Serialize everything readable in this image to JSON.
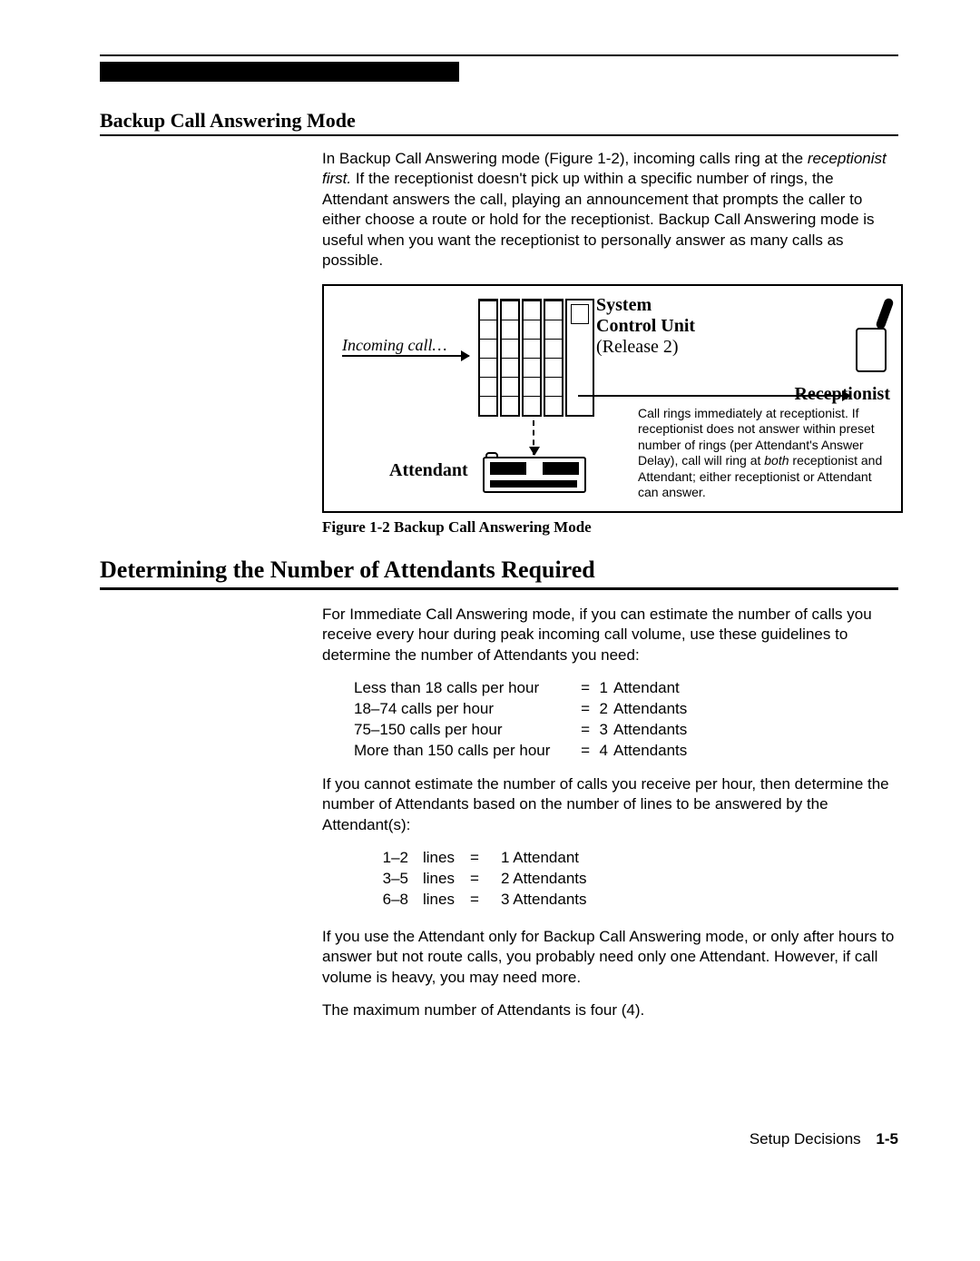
{
  "section1": {
    "title": "Backup Call Answering Mode",
    "para": "In Backup Call Answering mode (Figure 1-2), incoming calls ring at the ",
    "para_it1": "receptionist first.",
    "para_cont": " If the receptionist doesn't pick up within a specific number of rings, the Attendant answers the call, playing an announcement that prompts the caller to either choose a route or hold for the receptionist. Backup Call Answering mode is useful when you want the receptionist to personally answer as many calls as possible."
  },
  "figure": {
    "system_l1": "System",
    "system_l2": "Control Unit",
    "system_l3": "(Release 2)",
    "incoming": "Incoming call…",
    "receptionist": "Receptionist",
    "attendant": "Attendant",
    "caption_text": "Call rings immediately at receptionist. If receptionist does not answer within preset number of rings (per Attendant's Answer Delay), call will ring at ",
    "caption_it": "both",
    "caption_cont": " receptionist and Attendant; either receptionist or Attendant can answer.",
    "caption_label": "Figure 1-2   Backup Call Answering Mode"
  },
  "section2": {
    "title": "Determining the Number of Attendants Required",
    "p1": "For Immediate Call Answering mode, if you can estimate the number of calls you receive every hour during peak incoming call volume, use these guidelines to determine the number of Attendants you need:",
    "rules": [
      {
        "cond": "Less than 18 calls per hour",
        "n": "1",
        "att": "Attendant"
      },
      {
        "cond": "18–74 calls per hour",
        "n": "2",
        "att": "Attendants"
      },
      {
        "cond": "75–150 calls per hour",
        "n": "3",
        "att": "Attendants"
      },
      {
        "cond": "More than 150 calls per hour",
        "n": "4",
        "att": "Attendants"
      }
    ],
    "p2": "If you cannot estimate the number of calls you receive per hour, then determine the number of Attendants based on the number of lines to be answered by the Attendant(s):",
    "lines": [
      {
        "r": "1–2",
        "w": "lines",
        "eq": "=",
        "a": "1 Attendant"
      },
      {
        "r": "3–5",
        "w": "lines",
        "eq": "=",
        "a": "2 Attendants"
      },
      {
        "r": "6–8",
        "w": "lines",
        "eq": "=",
        "a": "3 Attendants"
      }
    ],
    "p3": "If you use the Attendant only for Backup Call Answering mode, or only after hours to answer but not route calls, you probably need only one Attendant. However, if call volume is heavy, you may need more.",
    "p4": "The maximum number of Attendants is four (4)."
  },
  "footer": {
    "section": "Setup Decisions",
    "page": "1-5"
  }
}
